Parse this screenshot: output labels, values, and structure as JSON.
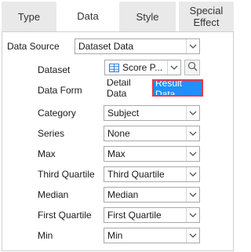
{
  "tabs": [
    {
      "label": "Type"
    },
    {
      "label": "Data"
    },
    {
      "label": "Style"
    },
    {
      "label": "Special\nEffect"
    }
  ],
  "data_source": {
    "label": "Data Source",
    "value": "Dataset Data"
  },
  "dataset": {
    "label": "Dataset",
    "value": "Score P...",
    "icon": "dataset-table-icon"
  },
  "data_form": {
    "label": "Data Form",
    "options": [
      "Detail",
      "Data",
      "Result",
      "Data"
    ],
    "selected": "Result Data"
  },
  "fields": [
    {
      "label": "Category",
      "value": "Subject"
    },
    {
      "label": "Series",
      "value": "None"
    },
    {
      "label": "Max",
      "value": "Max"
    },
    {
      "label": "Third Quartile",
      "value": "Third Quartile"
    },
    {
      "label": "Median",
      "value": "Median"
    },
    {
      "label": "First Quartile",
      "value": "First Quartile"
    },
    {
      "label": "Min",
      "value": "Min"
    }
  ],
  "colors": {
    "accent": "#1e90ff",
    "highlight_border": "#e63946"
  }
}
